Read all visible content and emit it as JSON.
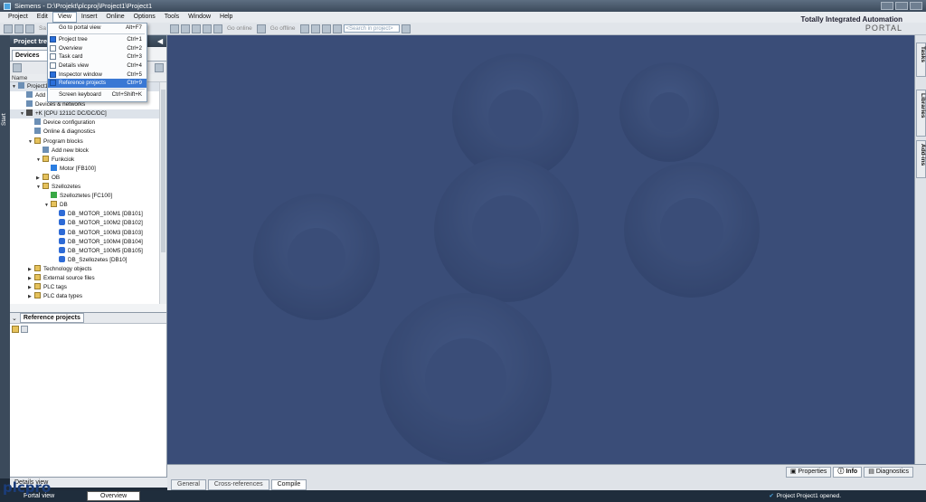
{
  "window": {
    "title": "Siemens - D:\\Projekt\\plcproj\\Project1\\Project1"
  },
  "menubar": [
    "Project",
    "Edit",
    "View",
    "Insert",
    "Online",
    "Options",
    "Tools",
    "Window",
    "Help"
  ],
  "toolbar": {
    "save_label": "Sa",
    "go_online": "Go online",
    "go_offline": "Go offline",
    "search_placeholder": "<Search in project>"
  },
  "brand": {
    "line1": "Totally Integrated Automation",
    "line2": "PORTAL"
  },
  "view_menu": {
    "items": [
      {
        "label": "Go to portal view",
        "shortcut": "Alt+F7",
        "check": "none"
      },
      {
        "label": "Project tree",
        "shortcut": "Ctrl+1",
        "check": "on"
      },
      {
        "label": "Overview",
        "shortcut": "Ctrl+2",
        "check": "off"
      },
      {
        "label": "Task card",
        "shortcut": "Ctrl+3",
        "check": "off"
      },
      {
        "label": "Details view",
        "shortcut": "Ctrl+4",
        "check": "off"
      },
      {
        "label": "Inspector window",
        "shortcut": "Ctrl+5",
        "check": "on"
      },
      {
        "label": "Reference projects",
        "shortcut": "Ctrl+9",
        "check": "on"
      },
      {
        "label": "Screen keyboard",
        "shortcut": "Ctrl+Shift+K",
        "check": "none"
      }
    ]
  },
  "left_strip": {
    "start": "Start"
  },
  "project_tree": {
    "title": "Project tre",
    "tab": "Devices",
    "name_col": "Name",
    "nodes": [
      {
        "label": "Project1",
        "indent": 0,
        "icon": "gen",
        "tri": "▼",
        "sel": true
      },
      {
        "label": "Add new device",
        "indent": 1,
        "icon": "gen",
        "tri": ""
      },
      {
        "label": "Devices & networks",
        "indent": 1,
        "icon": "gen",
        "tri": ""
      },
      {
        "label": "+K [CPU 1211C DC/DC/DC]",
        "indent": 1,
        "icon": "plc",
        "tri": "▼",
        "sel": true
      },
      {
        "label": "Device configuration",
        "indent": 2,
        "icon": "gen",
        "tri": ""
      },
      {
        "label": "Online & diagnostics",
        "indent": 2,
        "icon": "gen",
        "tri": ""
      },
      {
        "label": "Program blocks",
        "indent": 2,
        "icon": "folder",
        "tri": "▼"
      },
      {
        "label": "Add new block",
        "indent": 3,
        "icon": "gen",
        "tri": ""
      },
      {
        "label": "Funkciok",
        "indent": 3,
        "icon": "folder",
        "tri": "▼"
      },
      {
        "label": "Motor [FB100]",
        "indent": 4,
        "icon": "fb",
        "tri": ""
      },
      {
        "label": "OB",
        "indent": 3,
        "icon": "folder",
        "tri": "▶"
      },
      {
        "label": "Szellozetes",
        "indent": 3,
        "icon": "folder",
        "tri": "▼"
      },
      {
        "label": "Szelloztetes [FC100]",
        "indent": 4,
        "icon": "fc",
        "tri": ""
      },
      {
        "label": "DB",
        "indent": 4,
        "icon": "folder",
        "tri": "▼"
      },
      {
        "label": "DB_MOTOR_100M1 [DB101]",
        "indent": 5,
        "icon": "db",
        "tri": ""
      },
      {
        "label": "DB_MOTOR_100M2 [DB102]",
        "indent": 5,
        "icon": "db",
        "tri": ""
      },
      {
        "label": "DB_MOTOR_100M3 [DB103]",
        "indent": 5,
        "icon": "db",
        "tri": ""
      },
      {
        "label": "DB_MOTOR_100M4 [DB104]",
        "indent": 5,
        "icon": "db",
        "tri": ""
      },
      {
        "label": "DB_MOTOR_100M5 [DB105]",
        "indent": 5,
        "icon": "db",
        "tri": ""
      },
      {
        "label": "DB_Szellozetes [DB10]",
        "indent": 5,
        "icon": "db",
        "tri": ""
      },
      {
        "label": "Technology objects",
        "indent": 2,
        "icon": "folder",
        "tri": "▶"
      },
      {
        "label": "External source files",
        "indent": 2,
        "icon": "folder",
        "tri": "▶"
      },
      {
        "label": "PLC tags",
        "indent": 2,
        "icon": "folder",
        "tri": "▶"
      },
      {
        "label": "PLC data types",
        "indent": 2,
        "icon": "folder",
        "tri": "▶"
      }
    ]
  },
  "reference_projects": {
    "title": "Reference projects"
  },
  "details_view": {
    "label": "Details view"
  },
  "right_tabs": [
    "Tasks",
    "Libraries",
    "Add-ins"
  ],
  "inspector": {
    "tabs": [
      "Properties",
      "Info",
      "Diagnostics"
    ],
    "active": "Info",
    "bottom_tabs": [
      "General",
      "Cross-references",
      "Compile"
    ],
    "bottom_active": "Compile"
  },
  "statusbar": {
    "portal_view": "Portal view",
    "overview": "Overview",
    "message": "Project Project1 opened."
  },
  "watermark": "plcpro",
  "colors": {
    "workarea": "#3a4d78",
    "highlight": "#3a78d4",
    "titlebar": "#3b4a5b"
  }
}
